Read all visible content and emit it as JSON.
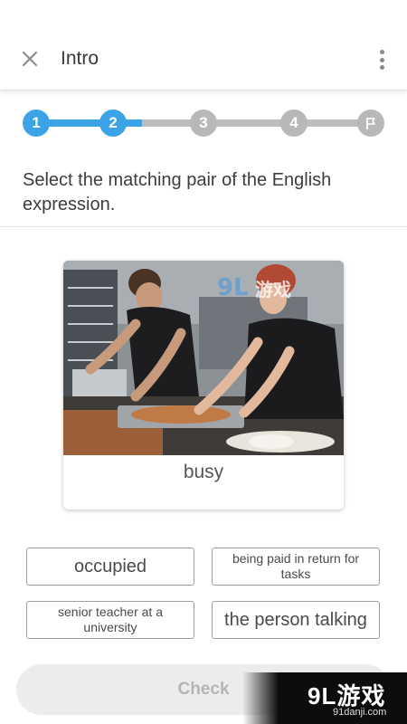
{
  "header": {
    "title": "Intro"
  },
  "progress": {
    "steps": [
      "1",
      "2",
      "3",
      "4"
    ],
    "current_step": 2,
    "colors": {
      "active": "#3ba3e6",
      "inactive": "#b8b8b8"
    }
  },
  "question": {
    "instruction": "Select the matching pair of the English expression."
  },
  "card": {
    "word": "busy"
  },
  "options": [
    {
      "label": "occupied"
    },
    {
      "label": "being paid in return for tasks"
    },
    {
      "label": "senior teacher at a university"
    },
    {
      "label": "the person talking"
    }
  ],
  "footer": {
    "check_label": "Check"
  },
  "watermark": {
    "brand": "9L游戏",
    "domain": "91danji.com",
    "image_brand": "游戏"
  }
}
